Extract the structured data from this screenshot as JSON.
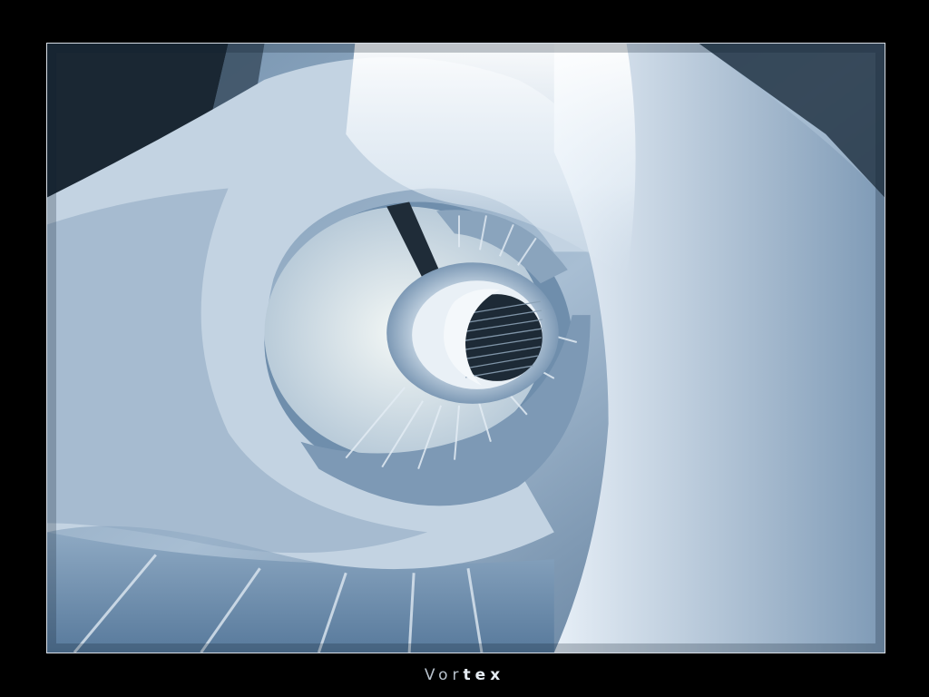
{
  "caption": {
    "light": "Vor",
    "bold": "tex"
  },
  "colors": {
    "background": "#000000",
    "frame_border": "#d8dee6",
    "wall_light": "#e9f1f8",
    "wall_mid": "#a9bfd4",
    "wall_dark": "#5f7f9f",
    "step_edge": "#dfe9f2",
    "core_dark": "#1d2a36"
  }
}
